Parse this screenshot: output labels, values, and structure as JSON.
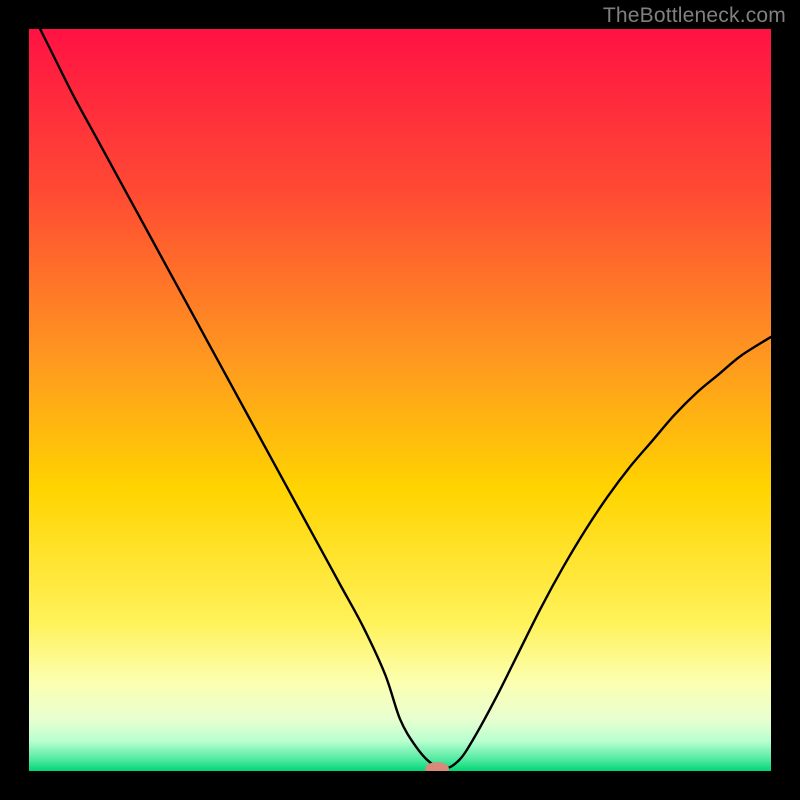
{
  "watermark": "TheBottleneck.com",
  "colors": {
    "background": "#000000",
    "gradient_top": "#ff1244",
    "gradient_mid_upper": "#ff7429",
    "gradient_mid": "#ffd400",
    "gradient_mid_lower": "#fff66a",
    "gradient_pale": "#f4ffc5",
    "gradient_green": "#00e17a",
    "curve_stroke": "#000000",
    "marker_fill": "#d98a7b"
  },
  "chart_data": {
    "type": "line",
    "title": "",
    "xlabel": "",
    "ylabel": "",
    "xlim": [
      0,
      100
    ],
    "ylim": [
      0,
      100
    ],
    "grid": false,
    "series": [
      {
        "name": "bottleneck-curve",
        "x": [
          0,
          3,
          6,
          9,
          12,
          15,
          18,
          21,
          24,
          27,
          30,
          33,
          36,
          39,
          42,
          45,
          48,
          50,
          52,
          54,
          56,
          58,
          60,
          63,
          66,
          69,
          72,
          75,
          78,
          81,
          84,
          87,
          90,
          93,
          96,
          100
        ],
        "y": [
          103,
          97,
          91,
          85.5,
          80,
          74.5,
          69,
          63.5,
          58,
          52.5,
          47,
          41.5,
          36,
          30.5,
          25,
          19.5,
          13,
          7,
          3.5,
          1.2,
          0.3,
          1.5,
          4.5,
          10,
          16,
          22,
          27.5,
          32.5,
          37,
          41,
          44.5,
          48,
          51,
          53.5,
          56,
          58.5
        ]
      }
    ],
    "marker": {
      "x": 55,
      "y": 0.3,
      "rx": 1.6,
      "ry": 0.9
    },
    "annotations": []
  }
}
